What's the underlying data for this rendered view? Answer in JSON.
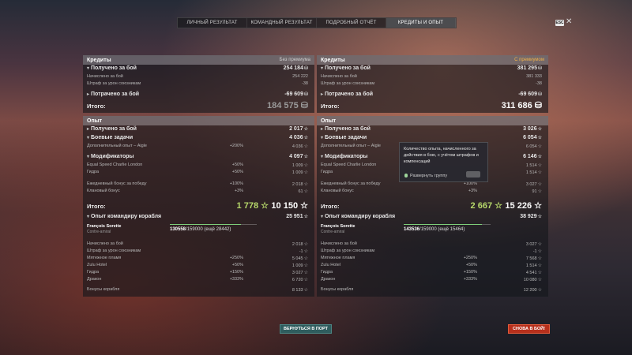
{
  "tabs": [
    "ЛИЧНЫЙ РЕЗУЛЬТАТ",
    "КОМАНДНЫЙ РЕЗУЛЬТАТ",
    "ПОДРОБНЫЙ ОТЧЁТ",
    "КРЕДИТЫ И ОПЫТ"
  ],
  "exit_label": "ESC",
  "close_icon": "close-icon",
  "left": {
    "credits_title": "Кредиты",
    "credits_sub": "Без премиума",
    "earned_label": "Получено за бой",
    "earned_value": "254 184",
    "earned_rows": [
      {
        "label": "Начислено за бой",
        "value": "254 222"
      },
      {
        "label": "Штраф за урон союзникам",
        "value": "-38"
      }
    ],
    "spent_label": "Потрачено за бой",
    "spent_value": "-69 609",
    "credits_total_label": "Итого:",
    "credits_total_value": "184 575",
    "xp_title": "Опыт",
    "xp_earned_label": "Получено за бой",
    "xp_earned_value": "2 017",
    "tasks_label": "Боевые задачи",
    "tasks_value": "4 036",
    "tasks_rows": [
      {
        "label": "Дополнительный опыт – Aigle",
        "pct": "+200%",
        "value": "4 036"
      }
    ],
    "mods_label": "Модификаторы",
    "mods_value": "4 097",
    "mods_rows": [
      {
        "label": "Equal Speed Charlie London",
        "pct": "+50%",
        "value": "1 009"
      },
      {
        "label": "Гидра",
        "pct": "+50%",
        "value": "1 009"
      },
      {
        "label": "Ежедневный бонус за победу",
        "pct": "+100%",
        "value": "2 018"
      },
      {
        "label": "Клановый бонус",
        "pct": "+3%",
        "value": "61"
      }
    ],
    "xp_total_label": "Итого:",
    "xp_total_free": "1 778",
    "xp_total_value": "10 150",
    "cmdr_section_label": "Опыт командиру корабля",
    "cmdr_section_value": "25 951",
    "cmdr_name": "François Sorette",
    "cmdr_rank": "Contre-amiral",
    "cmdr_xp_current": "130558",
    "cmdr_xp_max": "/159000",
    "cmdr_xp_left": "(ещё 28442)",
    "cmdr_progress": 0.82,
    "cmdr_rows": [
      {
        "label": "Начислено за бой",
        "pct": "",
        "value": "2 018"
      },
      {
        "label": "Штраф за урон союзникам",
        "pct": "",
        "value": "-1"
      },
      {
        "label": "Мятежное пламя",
        "pct": "+250%",
        "value": "5 045"
      },
      {
        "label": "Zulu Hotel",
        "pct": "+50%",
        "value": "1 009"
      },
      {
        "label": "Гидра",
        "pct": "+150%",
        "value": "3 027"
      },
      {
        "label": "Дракон",
        "pct": "+333%",
        "value": "6 720"
      }
    ],
    "ship_bonus_label": "Бонусы корабля",
    "ship_bonus_value": "8 133"
  },
  "right": {
    "credits_title": "Кредиты",
    "credits_sub": "С премиумом",
    "earned_label": "Получено за бой",
    "earned_value": "381 295",
    "earned_rows": [
      {
        "label": "Начислено за бой",
        "value": "381 333"
      },
      {
        "label": "Штраф за урон союзникам",
        "value": "-38"
      }
    ],
    "spent_label": "Потрачено за бой",
    "spent_value": "-69 609",
    "credits_total_label": "Итого:",
    "credits_total_value": "311 686",
    "xp_title": "Опыт",
    "xp_earned_label": "Получено за бой",
    "xp_earned_value": "3 026",
    "tasks_label": "Боевые задачи",
    "tasks_value": "6 054",
    "tasks_rows": [
      {
        "label": "Дополнительный опыт – Aigle",
        "pct": "",
        "value": "6 054"
      }
    ],
    "mods_label": "Модификаторы",
    "mods_value": "6 146",
    "mods_rows": [
      {
        "label": "Equal Speed Charlie London",
        "pct": "",
        "value": "1 514"
      },
      {
        "label": "Гидра",
        "pct": "",
        "value": "1 514"
      },
      {
        "label": "Ежедневный бонус за победу",
        "pct": "+100%",
        "value": "3 027"
      },
      {
        "label": "Клановый бонус",
        "pct": "+3%",
        "value": "91"
      }
    ],
    "xp_total_label": "Итого:",
    "xp_total_free": "2 667",
    "xp_total_value": "15 226",
    "cmdr_section_label": "Опыт командиру корабля",
    "cmdr_section_value": "38 929",
    "cmdr_name": "François Sorette",
    "cmdr_rank": "Contre-amiral",
    "cmdr_xp_current": "143536",
    "cmdr_xp_max": "/159000",
    "cmdr_xp_left": "(ещё 15464)",
    "cmdr_progress": 0.9,
    "cmdr_rows": [
      {
        "label": "Начислено за бой",
        "pct": "",
        "value": "3 027"
      },
      {
        "label": "Штраф за урон союзникам",
        "pct": "",
        "value": "-1"
      },
      {
        "label": "Мятежное пламя",
        "pct": "+250%",
        "value": "7 568"
      },
      {
        "label": "Zulu Hotel",
        "pct": "+50%",
        "value": "1 514"
      },
      {
        "label": "Гидра",
        "pct": "+150%",
        "value": "4 541"
      },
      {
        "label": "Дракон",
        "pct": "+333%",
        "value": "10 080"
      }
    ],
    "ship_bonus_label": "Бонусы корабля",
    "ship_bonus_value": "12 200"
  },
  "tooltip": {
    "text": "Количество опыта, начисленного за действия в бою, с учётом штрафов и компенсаций",
    "expand": "Развернуть группу"
  },
  "buttons": {
    "port": "ВЕРНУТЬСЯ В ПОРТ",
    "battle": "СНОВА В БОЙ!"
  },
  "colors": {
    "premium": "#f1b24a",
    "free_xp": "#b7d96b",
    "port_button": "#2f5d5e",
    "battle_button": "#b8301c"
  }
}
